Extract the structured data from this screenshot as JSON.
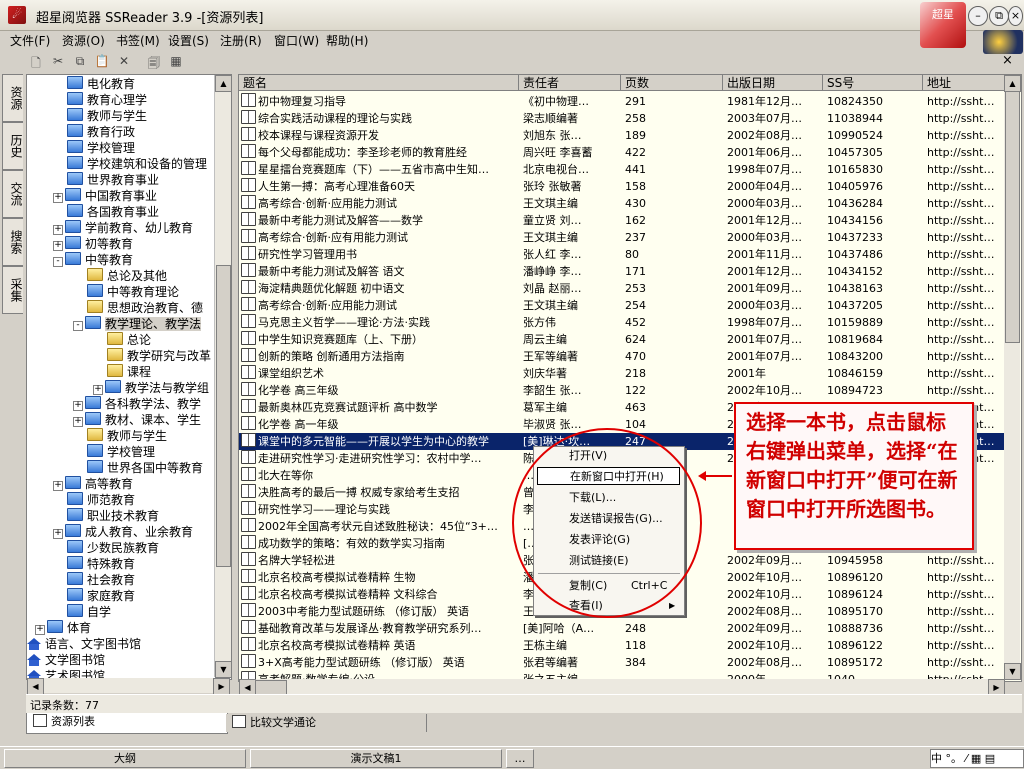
{
  "window": {
    "title": "超星阅览器 SSReader 3.9 -[资源列表]",
    "logo_text": "超星"
  },
  "menu": [
    "文件(F)",
    "资源(O)",
    "书签(M)",
    "设置(S)",
    "注册(R)",
    "窗口(W)",
    "帮助(H)"
  ],
  "toolbar": {
    "close_label": "×"
  },
  "side_tabs": [
    "资源",
    "历史",
    "交流",
    "搜索",
    "采集"
  ],
  "tree": {
    "items": [
      {
        "label": "电化教育",
        "icon": "folder-blue",
        "level": 3
      },
      {
        "label": "教育心理学",
        "icon": "folder-blue",
        "level": 3
      },
      {
        "label": "教师与学生",
        "icon": "folder-blue",
        "level": 3
      },
      {
        "label": "教育行政",
        "icon": "folder-blue",
        "level": 3
      },
      {
        "label": "学校管理",
        "icon": "folder-blue",
        "level": 3
      },
      {
        "label": "学校建筑和设备的管理",
        "icon": "folder-blue",
        "level": 3
      },
      {
        "label": "世界教育事业",
        "icon": "folder-blue",
        "level": 3
      },
      {
        "label": "中国教育事业",
        "icon": "folder-blue",
        "level": 3,
        "expander": "+"
      },
      {
        "label": "各国教育事业",
        "icon": "folder-blue",
        "level": 3
      },
      {
        "label": "学前教育、幼儿教育",
        "icon": "folder-blue",
        "level": 3,
        "expander": "+"
      },
      {
        "label": "初等教育",
        "icon": "folder-blue",
        "level": 3,
        "expander": "+"
      },
      {
        "label": "中等教育",
        "icon": "folder-blue",
        "level": 3,
        "expander": "-"
      },
      {
        "label": "总论及其他",
        "icon": "folder-yellow",
        "level": 4
      },
      {
        "label": "中等教育理论",
        "icon": "folder-blue",
        "level": 4
      },
      {
        "label": "思想政治教育、德",
        "icon": "folder-yellow",
        "level": 4
      },
      {
        "label": "教学理论、教学法",
        "icon": "folder-blue",
        "level": 4,
        "expander": "-"
      },
      {
        "label": "总论",
        "icon": "folder-yellow",
        "level": 5
      },
      {
        "label": "教学研究与改革",
        "icon": "folder-yellow",
        "level": 5
      },
      {
        "label": "课程",
        "icon": "folder-yellow",
        "level": 5
      },
      {
        "label": "教学法与教学组",
        "icon": "folder-blue",
        "level": 5,
        "expander": "+"
      },
      {
        "label": "各科教学法、教学",
        "icon": "folder-blue",
        "level": 4,
        "expander": "+"
      },
      {
        "label": "教材、课本、学生",
        "icon": "folder-blue",
        "level": 4,
        "expander": "+"
      },
      {
        "label": "教师与学生",
        "icon": "folder-yellow",
        "level": 4
      },
      {
        "label": "学校管理",
        "icon": "folder-blue",
        "level": 4
      },
      {
        "label": "世界各国中等教育",
        "icon": "folder-blue",
        "level": 4
      },
      {
        "label": "高等教育",
        "icon": "folder-blue",
        "level": 3,
        "expander": "+"
      },
      {
        "label": "师范教育",
        "icon": "folder-blue",
        "level": 3
      },
      {
        "label": "职业技术教育",
        "icon": "folder-blue",
        "level": 3
      },
      {
        "label": "成人教育、业余教育",
        "icon": "folder-blue",
        "level": 3,
        "expander": "+"
      },
      {
        "label": "少数民族教育",
        "icon": "folder-blue",
        "level": 3
      },
      {
        "label": "特殊教育",
        "icon": "folder-blue",
        "level": 3
      },
      {
        "label": "社会教育",
        "icon": "folder-blue",
        "level": 3
      },
      {
        "label": "家庭教育",
        "icon": "folder-blue",
        "level": 3
      },
      {
        "label": "自学",
        "icon": "folder-blue",
        "level": 3
      },
      {
        "label": "体育",
        "icon": "folder-blue",
        "level": 2,
        "expander": "+"
      },
      {
        "label": "语言、文字图书馆",
        "icon": "library",
        "level": 1,
        "expander": "+"
      },
      {
        "label": "文学图书馆",
        "icon": "library",
        "level": 1,
        "expander": "+"
      },
      {
        "label": "艺术图书馆",
        "icon": "library",
        "level": 1,
        "expander": "+"
      }
    ]
  },
  "table": {
    "columns": [
      "题名",
      "责任者",
      "页数",
      "出版日期",
      "SS号",
      "地址"
    ],
    "selected_index": 20,
    "rows": [
      [
        "初中物理复习指导",
        "《初中物理…",
        "291",
        "1981年12月…",
        "10824350",
        "http://ssht…"
      ],
      [
        "综合实践活动课程的理论与实践",
        "梁志顺编著",
        "258",
        "2003年07月…",
        "11038944",
        "http://ssht…"
      ],
      [
        "校本课程与课程资源开发",
        "刘旭东 张…",
        "189",
        "2002年08月…",
        "10990524",
        "http://ssht…"
      ],
      [
        "每个父母都能成功：李圣珍老师的教育胜经",
        "周兴旺 李喜蓄",
        "422",
        "2001年06月…",
        "10457305",
        "http://ssht…"
      ],
      [
        "星星擂台竞赛题库（下）——五省市高中生知…",
        "北京电视台…",
        "441",
        "1998年07月…",
        "10165830",
        "http://ssht…"
      ],
      [
        "人生第一搏：高考心理准备60天",
        "张玲 张敏著",
        "158",
        "2000年04月…",
        "10405976",
        "http://ssht…"
      ],
      [
        "高考综合·创新·应用能力测试",
        "王文琪主编",
        "430",
        "2000年03月…",
        "10436284",
        "http://ssht…"
      ],
      [
        "最新中考能力测试及解答——数学",
        "童立贤 刘…",
        "162",
        "2001年12月…",
        "10434156",
        "http://ssht…"
      ],
      [
        "高考综合·创新·应有用能力测试",
        "王文琪主编",
        "237",
        "2000年03月…",
        "10437233",
        "http://ssht…"
      ],
      [
        "研究性学习管理用书",
        "张人红 李…",
        "80",
        "2001年11月…",
        "10437486",
        "http://ssht…"
      ],
      [
        "最新中考能力测试及解答 语文",
        "潘峥峥 李…",
        "171",
        "2001年12月…",
        "10434152",
        "http://ssht…"
      ],
      [
        "海淀精典题优化解题 初中语文",
        "刘晶 赵丽…",
        "253",
        "2001年09月…",
        "10438163",
        "http://ssht…"
      ],
      [
        "高考综合·创新·应用能力测试",
        "王文琪主编",
        "254",
        "2000年03月…",
        "10437205",
        "http://ssht…"
      ],
      [
        "马克思主义哲学——理论·方法·实践",
        "张方伟",
        "452",
        "1998年07月…",
        "10159889",
        "http://ssht…"
      ],
      [
        "中学生知识竞赛题库（上、下册）",
        "周云主编",
        "624",
        "2001年07月…",
        "10819684",
        "http://ssht…"
      ],
      [
        "创新的策略 创新通用方法指南",
        "王军等编著",
        "470",
        "2001年07月…",
        "10843200",
        "http://ssht…"
      ],
      [
        "课堂组织艺术",
        "刘庆华著",
        "218",
        "2001年",
        "10846159",
        "http://ssht…"
      ],
      [
        "化学卷 高三年级",
        "李韶生 张…",
        "122",
        "2002年10月…",
        "10894723",
        "http://ssht…"
      ],
      [
        "最新奥林匹克竞赛试题评析 高中数学",
        "葛军主编",
        "463",
        "2002年…",
        "10…",
        "http://ssht…"
      ],
      [
        "化学卷 高一年级",
        "毕淑贤 张…",
        "104",
        "2…",
        "10…",
        "http://ssht…"
      ],
      [
        "课堂中的多元智能——开展以学生为中心的教学",
        "[美]琳达·坎…",
        "247",
        "2…",
        "10…",
        "http://ssht…"
      ],
      [
        "走进研究性学习·走进研究性学习：农村中学…",
        "陈…",
        "2…",
        "2…",
        "10…",
        "http://ssht…"
      ],
      [
        "北大在等你",
        "…",
        "",
        "",
        "",
        ""
      ],
      [
        "决胜高考的最后一搏 权威专家给考生支招",
        "曾…",
        "",
        "",
        "",
        ""
      ],
      [
        "研究性学习——理论与实践",
        "李…",
        "",
        "",
        "",
        ""
      ],
      [
        "2002年全国高考状元自述致胜秘诀：45位“3+…",
        "…",
        "",
        "",
        "",
        ""
      ],
      [
        "成功数学的策略：有效的数学实习指南",
        "[…",
        "",
        "",
        "",
        ""
      ],
      [
        "名牌大学轻松进",
        "张…",
        "",
        "2002年09月…",
        "10945958",
        "http://ssht…"
      ],
      [
        "北京名校高考模拟试卷精粹 生物",
        "潘…",
        "",
        "2002年10月…",
        "10896120",
        "http://ssht…"
      ],
      [
        "北京名校高考模拟试卷精粹 文科综合",
        "李…",
        "",
        "2002年10月…",
        "10896124",
        "http://ssht…"
      ],
      [
        "2003中考能力型试题研练 （修订版） 英语",
        "王…",
        "",
        "2002年08月…",
        "10895170",
        "http://ssht…"
      ],
      [
        "基础教育改革与发展译丛·教育教学研究系列…",
        "[美]阿哈（A…",
        "248",
        "2002年09月…",
        "10888736",
        "http://ssht…"
      ],
      [
        "北京名校高考模拟试卷精粹 英语",
        "王栋主编",
        "118",
        "2002年10月…",
        "10896122",
        "http://ssht…"
      ],
      [
        "3+X高考能力型试题研练 （修订版） 英语",
        "张君等编著",
        "384",
        "2002年08月…",
        "10895172",
        "http://ssht…"
      ],
      [
        "高考解题·数学专编·公设",
        "张之五主编",
        "…",
        "2000年…",
        "1040…",
        "http://ssht…"
      ]
    ]
  },
  "context_menu": {
    "items": [
      "打开(V)",
      "在新窗口中打开(H)",
      "下载(L)...",
      "发送错误报告(G)...",
      "发表评论(G)",
      "测试链接(E)",
      "复制(C)",
      "查看(I)"
    ],
    "shortcut_copy": "Ctrl+C",
    "submenu_arrow": "▶"
  },
  "callout": {
    "text": "选择一本书，点击鼠标右键弹出菜单，选择“在新窗口中打开”便可在新窗口中打开所选图书。"
  },
  "status": {
    "record_count": "记录条数：77"
  },
  "bottom_tabs": [
    "资源列表",
    "比较文学通论"
  ],
  "taskbar": {
    "items": [
      "大纲",
      "演示文稿1",
      "…"
    ],
    "ime": "中 °。 ⁄ ▦ ▤"
  },
  "colors": {
    "selection": "#0a246a",
    "callout_red": "#e00000",
    "table_bg": "#fffff0"
  }
}
